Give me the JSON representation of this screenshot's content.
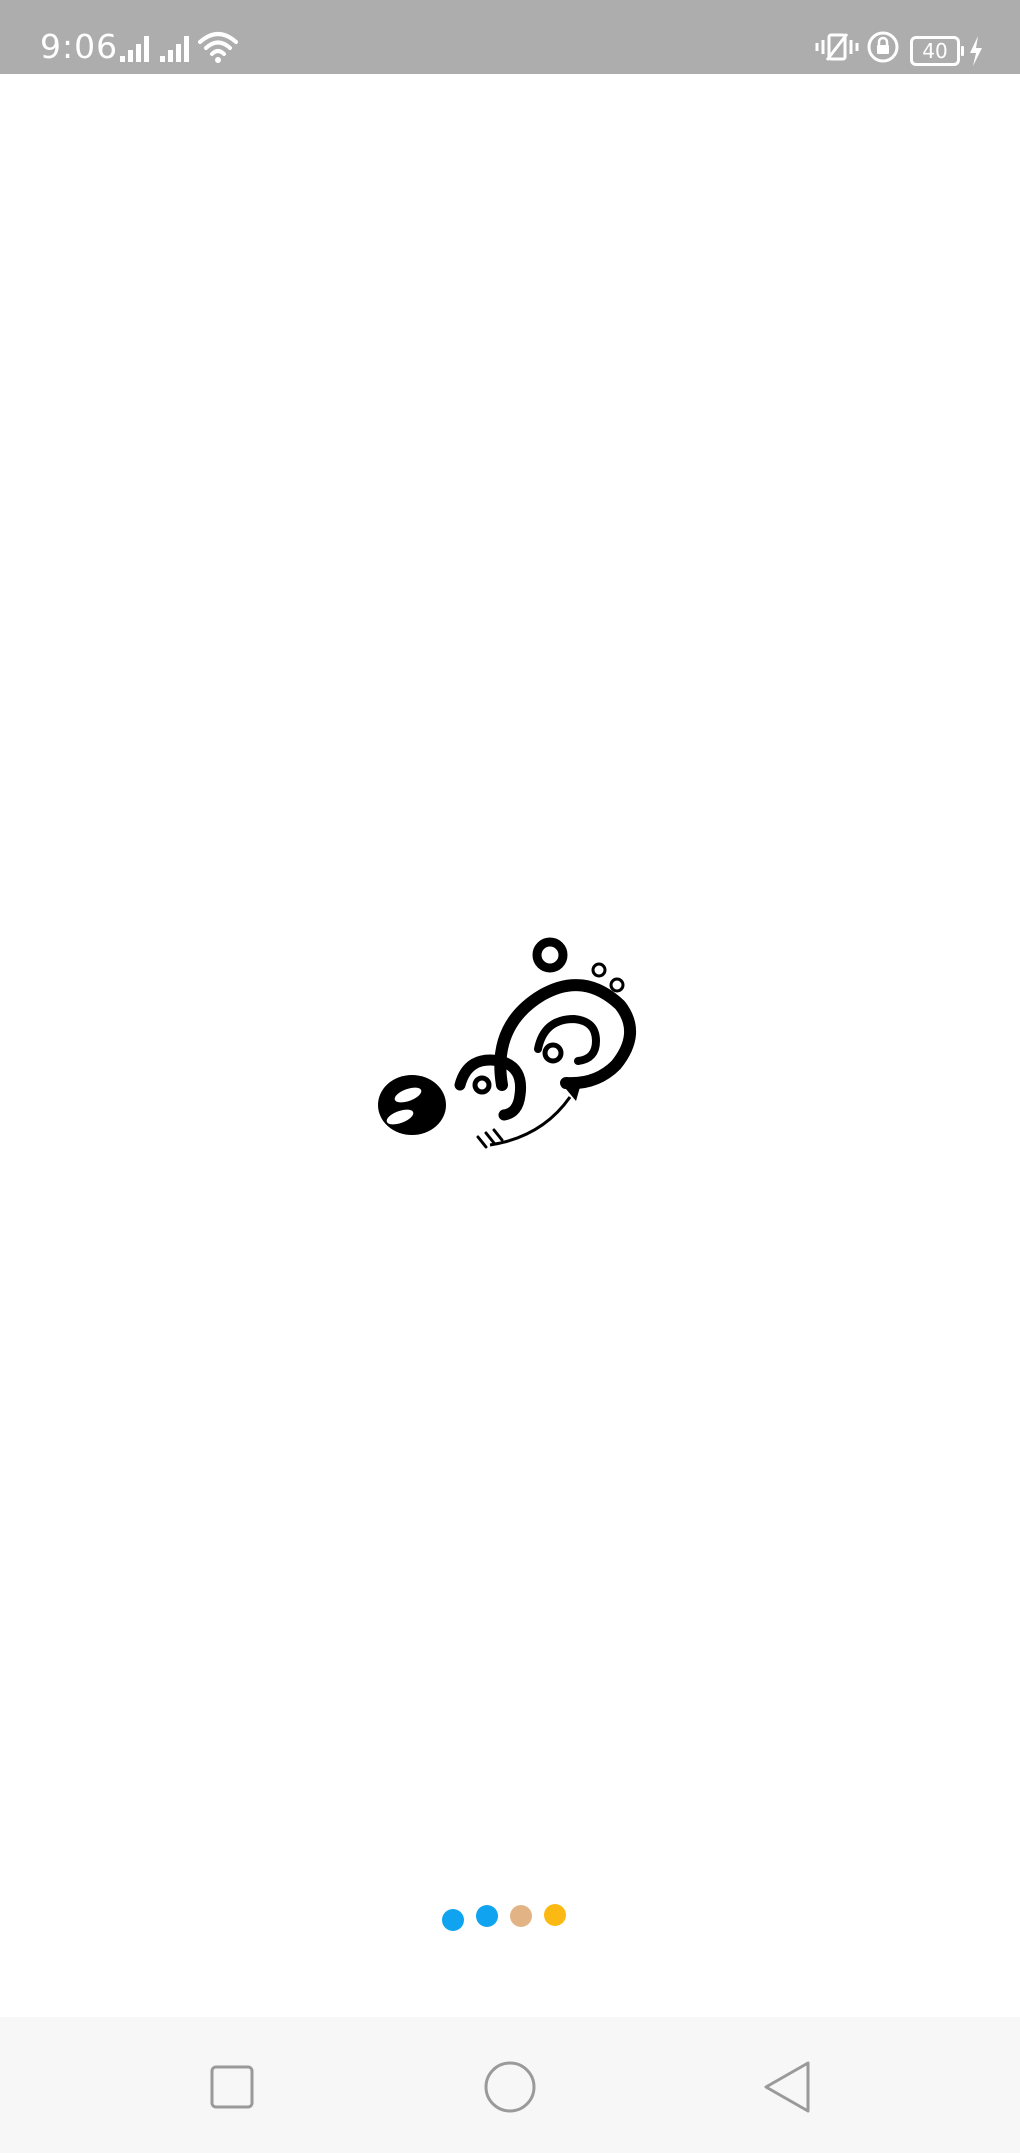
{
  "status_bar": {
    "time": "9:06",
    "battery_level": "40",
    "icons": [
      "signal-icon",
      "signal-icon",
      "wifi-icon",
      "vibrate-icon",
      "rotation-lock-icon",
      "battery-icon",
      "charging-icon"
    ],
    "background_color": "#adadad"
  },
  "splash": {
    "logo_icon": "app-logo-icon",
    "background_color": "#ffffff"
  },
  "loading_indicator": {
    "dot_colors": [
      "#10a3f0",
      "#10a3f0",
      "#e2b485",
      "#fdb913"
    ]
  },
  "nav_bar": {
    "buttons": [
      "recent-apps-icon",
      "home-icon",
      "back-icon"
    ],
    "background_color": "#f7f7f7"
  }
}
